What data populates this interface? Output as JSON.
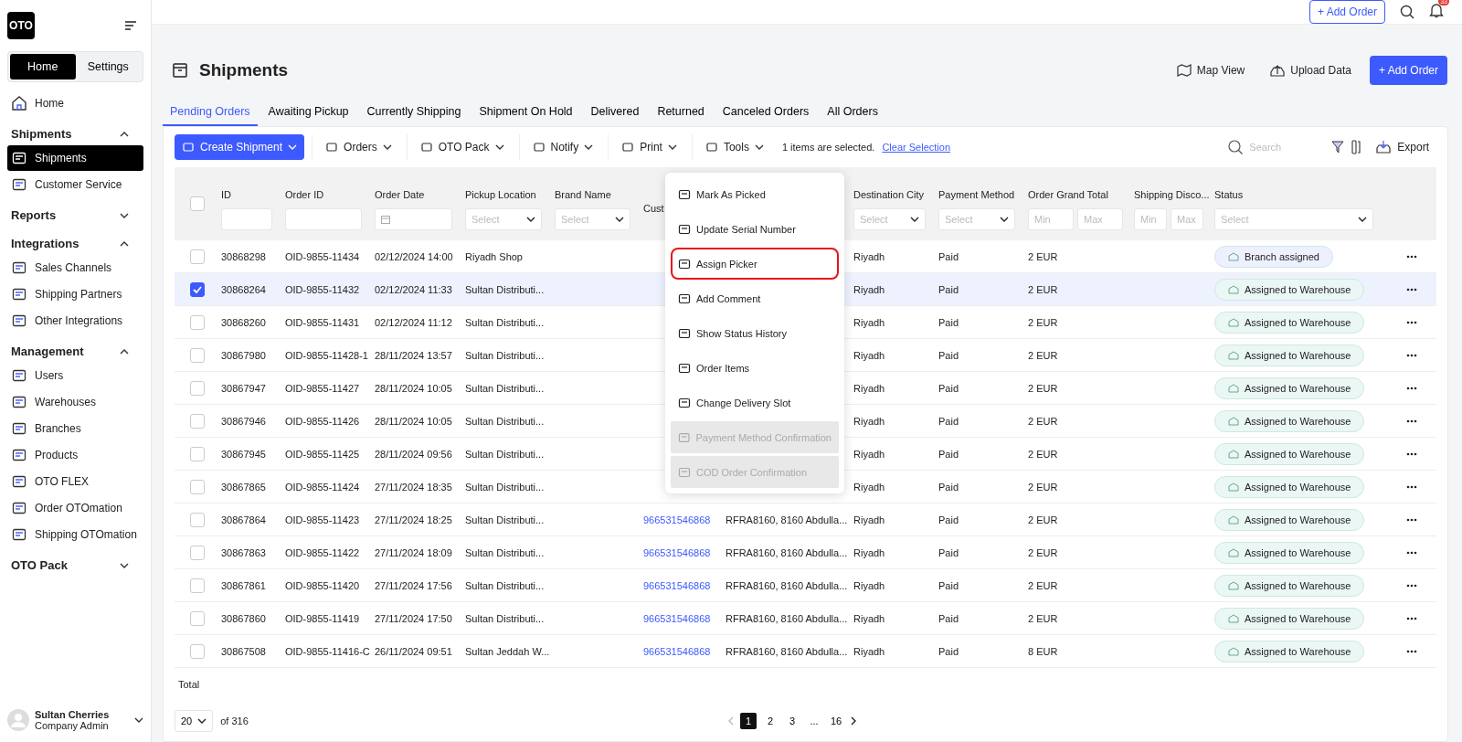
{
  "topbar": {
    "logo": "OTO",
    "add_order": "+ Add Order",
    "notifications": "33"
  },
  "sidebar": {
    "tabs": [
      {
        "label": "Home",
        "selected": true
      },
      {
        "label": "Settings",
        "selected": false
      }
    ],
    "home": {
      "label": "Home",
      "selected": false
    },
    "sections": [
      {
        "title": "Shipments",
        "expanded": true,
        "items": [
          {
            "label": "Shipments",
            "selected": true
          },
          {
            "label": "Customer Service",
            "selected": false
          }
        ]
      },
      {
        "title": "Reports",
        "expanded": false
      },
      {
        "title": "Integrations",
        "expanded": true,
        "items": [
          {
            "label": "Sales Channels",
            "selected": false
          },
          {
            "label": "Shipping Partners",
            "selected": false
          },
          {
            "label": "Other Integrations",
            "selected": false
          }
        ]
      },
      {
        "title": "Management",
        "expanded": true,
        "items": [
          {
            "label": "Users",
            "selected": false
          },
          {
            "label": "Warehouses",
            "selected": false
          },
          {
            "label": "Branches",
            "selected": false
          },
          {
            "label": "Products",
            "selected": false
          },
          {
            "label": "OTO FLEX",
            "selected": false
          },
          {
            "label": "Order OTOmation",
            "selected": false
          },
          {
            "label": "Shipping OTOmation",
            "selected": false
          }
        ]
      },
      {
        "title": "OTO Pack",
        "expanded": false
      }
    ],
    "user": {
      "name": "Sultan Cherries",
      "role": "Company Admin"
    }
  },
  "page": {
    "title": "Shipments",
    "actions": [
      {
        "label": "Map View",
        "kind": "plain"
      },
      {
        "label": "Upload Data",
        "kind": "plain"
      },
      {
        "label": "+ Add Order",
        "kind": "primary"
      }
    ]
  },
  "tabs": [
    {
      "label": "Pending Orders",
      "selected": true
    },
    {
      "label": "Awaiting Pickup",
      "selected": false
    },
    {
      "label": "Currently Shipping",
      "selected": false
    },
    {
      "label": "Shipment On Hold",
      "selected": false
    },
    {
      "label": "Delivered",
      "selected": false
    },
    {
      "label": "Returned",
      "selected": false
    },
    {
      "label": "Canceled Orders",
      "selected": false
    },
    {
      "label": "All Orders",
      "selected": false
    }
  ],
  "toolbar": {
    "buttons": [
      {
        "label": "Create Shipment",
        "kind": "primary"
      },
      {
        "label": "Orders",
        "kind": "plain"
      },
      {
        "label": "OTO Pack",
        "kind": "plain"
      },
      {
        "label": "Notify",
        "kind": "plain"
      },
      {
        "label": "Print",
        "kind": "plain"
      },
      {
        "label": "Tools",
        "kind": "plain"
      }
    ],
    "selection": "1 items are selected.",
    "clear": "Clear Selection",
    "search": {
      "placeholder": "Search"
    },
    "export": "Export"
  },
  "table": {
    "select_all": {
      "checked": false
    },
    "columns": [
      {
        "label": "ID",
        "filter": {
          "kind": "text"
        }
      },
      {
        "label": "Order ID",
        "filter": {
          "kind": "text"
        }
      },
      {
        "label": "Order Date",
        "filter": {
          "kind": "date"
        }
      },
      {
        "label": "Pickup Location",
        "filter": {
          "kind": "select",
          "placeholder": "Select"
        }
      },
      {
        "label": "Brand Name",
        "filter": {
          "kind": "select",
          "placeholder": "Select"
        }
      },
      {
        "label": "Cust"
      },
      {},
      {
        "label": "Destination City",
        "filter": {
          "kind": "select",
          "placeholder": "Select"
        }
      },
      {
        "label": "Payment Method",
        "filter": {
          "kind": "select",
          "placeholder": "Select"
        }
      },
      {
        "label": "Order Grand Total",
        "filter": {
          "kind": "range",
          "fields": [
            {
              "placeholder": "Min"
            },
            {
              "placeholder": "Max"
            }
          ]
        }
      },
      {
        "label": "Shipping Disco...",
        "filter": {
          "kind": "range",
          "fields": [
            {
              "placeholder": "Min"
            },
            {
              "placeholder": "Max"
            }
          ]
        }
      },
      {
        "label": "Status",
        "filter": {
          "kind": "select",
          "placeholder": "Select"
        }
      }
    ],
    "rows": [
      {
        "checked": false,
        "cells": [
          "30868298",
          "OID-9855-11434",
          "02/12/2024 14:00",
          "Riyadh Shop",
          "",
          null,
          null,
          "Riyadh",
          "Paid",
          "2 EUR",
          ""
        ],
        "status": {
          "label": "Branch assigned",
          "color": "#eef0ff"
        }
      },
      {
        "checked": true,
        "cells": [
          "30868264",
          "OID-9855-11432",
          "02/12/2024 11:33",
          "Sultan Distributi...",
          "",
          null,
          null,
          "Riyadh",
          "Paid",
          "2 EUR",
          ""
        ],
        "status": {
          "label": "Assigned to Warehouse",
          "color": "#eaf7f4"
        }
      },
      {
        "checked": false,
        "cells": [
          "30868260",
          "OID-9855-11431",
          "02/12/2024 11:12",
          "Sultan Distributi...",
          "",
          null,
          null,
          "Riyadh",
          "Paid",
          "2 EUR",
          ""
        ],
        "status": {
          "label": "Assigned to Warehouse",
          "color": "#eaf7f4"
        }
      },
      {
        "checked": false,
        "cells": [
          "30867980",
          "OID-9855-11428-1",
          "28/11/2024 13:57",
          "Sultan Distributi...",
          "",
          null,
          null,
          "Riyadh",
          "Paid",
          "2 EUR",
          ""
        ],
        "status": {
          "label": "Assigned to Warehouse",
          "color": "#eaf7f4"
        }
      },
      {
        "checked": false,
        "cells": [
          "30867947",
          "OID-9855-11427",
          "28/11/2024 10:05",
          "Sultan Distributi...",
          "",
          null,
          null,
          "Riyadh",
          "Paid",
          "2 EUR",
          ""
        ],
        "status": {
          "label": "Assigned to Warehouse",
          "color": "#eaf7f4"
        }
      },
      {
        "checked": false,
        "cells": [
          "30867946",
          "OID-9855-11426",
          "28/11/2024 10:05",
          "Sultan Distributi...",
          "",
          null,
          null,
          "Riyadh",
          "Paid",
          "2 EUR",
          ""
        ],
        "status": {
          "label": "Assigned to Warehouse",
          "color": "#eaf7f4"
        }
      },
      {
        "checked": false,
        "cells": [
          "30867945",
          "OID-9855-11425",
          "28/11/2024 09:56",
          "Sultan Distributi...",
          "",
          null,
          null,
          "Riyadh",
          "Paid",
          "2 EUR",
          ""
        ],
        "status": {
          "label": "Assigned to Warehouse",
          "color": "#eaf7f4"
        }
      },
      {
        "checked": false,
        "cells": [
          "30867865",
          "OID-9855-11424",
          "27/11/2024 18:35",
          "Sultan Distributi...",
          "",
          null,
          null,
          "Riyadh",
          "Paid",
          "2 EUR",
          ""
        ],
        "status": {
          "label": "Assigned to Warehouse",
          "color": "#eaf7f4"
        }
      },
      {
        "checked": false,
        "cells": [
          "30867864",
          "OID-9855-11423",
          "27/11/2024 18:25",
          "Sultan Distributi...",
          "",
          "966531546868",
          "RFRA8160, 8160 Abdulla...",
          "Riyadh",
          "Paid",
          "2 EUR",
          ""
        ],
        "status": {
          "label": "Assigned to Warehouse",
          "color": "#eaf7f4"
        }
      },
      {
        "checked": false,
        "cells": [
          "30867863",
          "OID-9855-11422",
          "27/11/2024 18:09",
          "Sultan Distributi...",
          "",
          "966531546868",
          "RFRA8160, 8160 Abdulla...",
          "Riyadh",
          "Paid",
          "2 EUR",
          ""
        ],
        "status": {
          "label": "Assigned to Warehouse",
          "color": "#eaf7f4"
        }
      },
      {
        "checked": false,
        "cells": [
          "30867861",
          "OID-9855-11420",
          "27/11/2024 17:56",
          "Sultan Distributi...",
          "",
          "966531546868",
          "RFRA8160, 8160 Abdulla...",
          "Riyadh",
          "Paid",
          "2 EUR",
          ""
        ],
        "status": {
          "label": "Assigned to Warehouse",
          "color": "#eaf7f4"
        }
      },
      {
        "checked": false,
        "cells": [
          "30867860",
          "OID-9855-11419",
          "27/11/2024 17:50",
          "Sultan Distributi...",
          "",
          "966531546868",
          "RFRA8160, 8160 Abdulla...",
          "Riyadh",
          "Paid",
          "2 EUR",
          ""
        ],
        "status": {
          "label": "Assigned to Warehouse",
          "color": "#eaf7f4"
        }
      },
      {
        "checked": false,
        "cells": [
          "30867508",
          "OID-9855-11416-C",
          "26/11/2024 09:51",
          "Sultan Jeddah W...",
          "",
          "966531546868",
          "RFRA8160, 8160 Abdulla...",
          "Riyadh",
          "Paid",
          "8 EUR",
          ""
        ],
        "status": {
          "label": "Assigned to Warehouse",
          "color": "#eaf7f4"
        }
      }
    ],
    "total_label": "Total"
  },
  "tools_menu": [
    {
      "label": "Mark As Picked",
      "disabled": false,
      "highlighted": false
    },
    {
      "label": "Update Serial Number",
      "disabled": false,
      "highlighted": false
    },
    {
      "label": "Assign Picker",
      "disabled": false,
      "highlighted": true
    },
    {
      "label": "Add Comment",
      "disabled": false,
      "highlighted": false
    },
    {
      "label": "Show Status History",
      "disabled": false,
      "highlighted": false
    },
    {
      "label": "Order Items",
      "disabled": false,
      "highlighted": false
    },
    {
      "label": "Change Delivery Slot",
      "disabled": false,
      "highlighted": false
    },
    {
      "label": "Payment Method Confirmation",
      "disabled": true,
      "highlighted": false
    },
    {
      "label": "COD Order Confirmation",
      "disabled": true,
      "highlighted": false
    }
  ],
  "pagination": {
    "page_size": "20",
    "of": "of 316",
    "pages": [
      {
        "label": "1",
        "selected": true
      },
      {
        "label": "2",
        "selected": false
      },
      {
        "label": "3",
        "selected": false
      },
      {
        "label": "...",
        "selected": false
      },
      {
        "label": "16",
        "selected": false
      }
    ]
  }
}
